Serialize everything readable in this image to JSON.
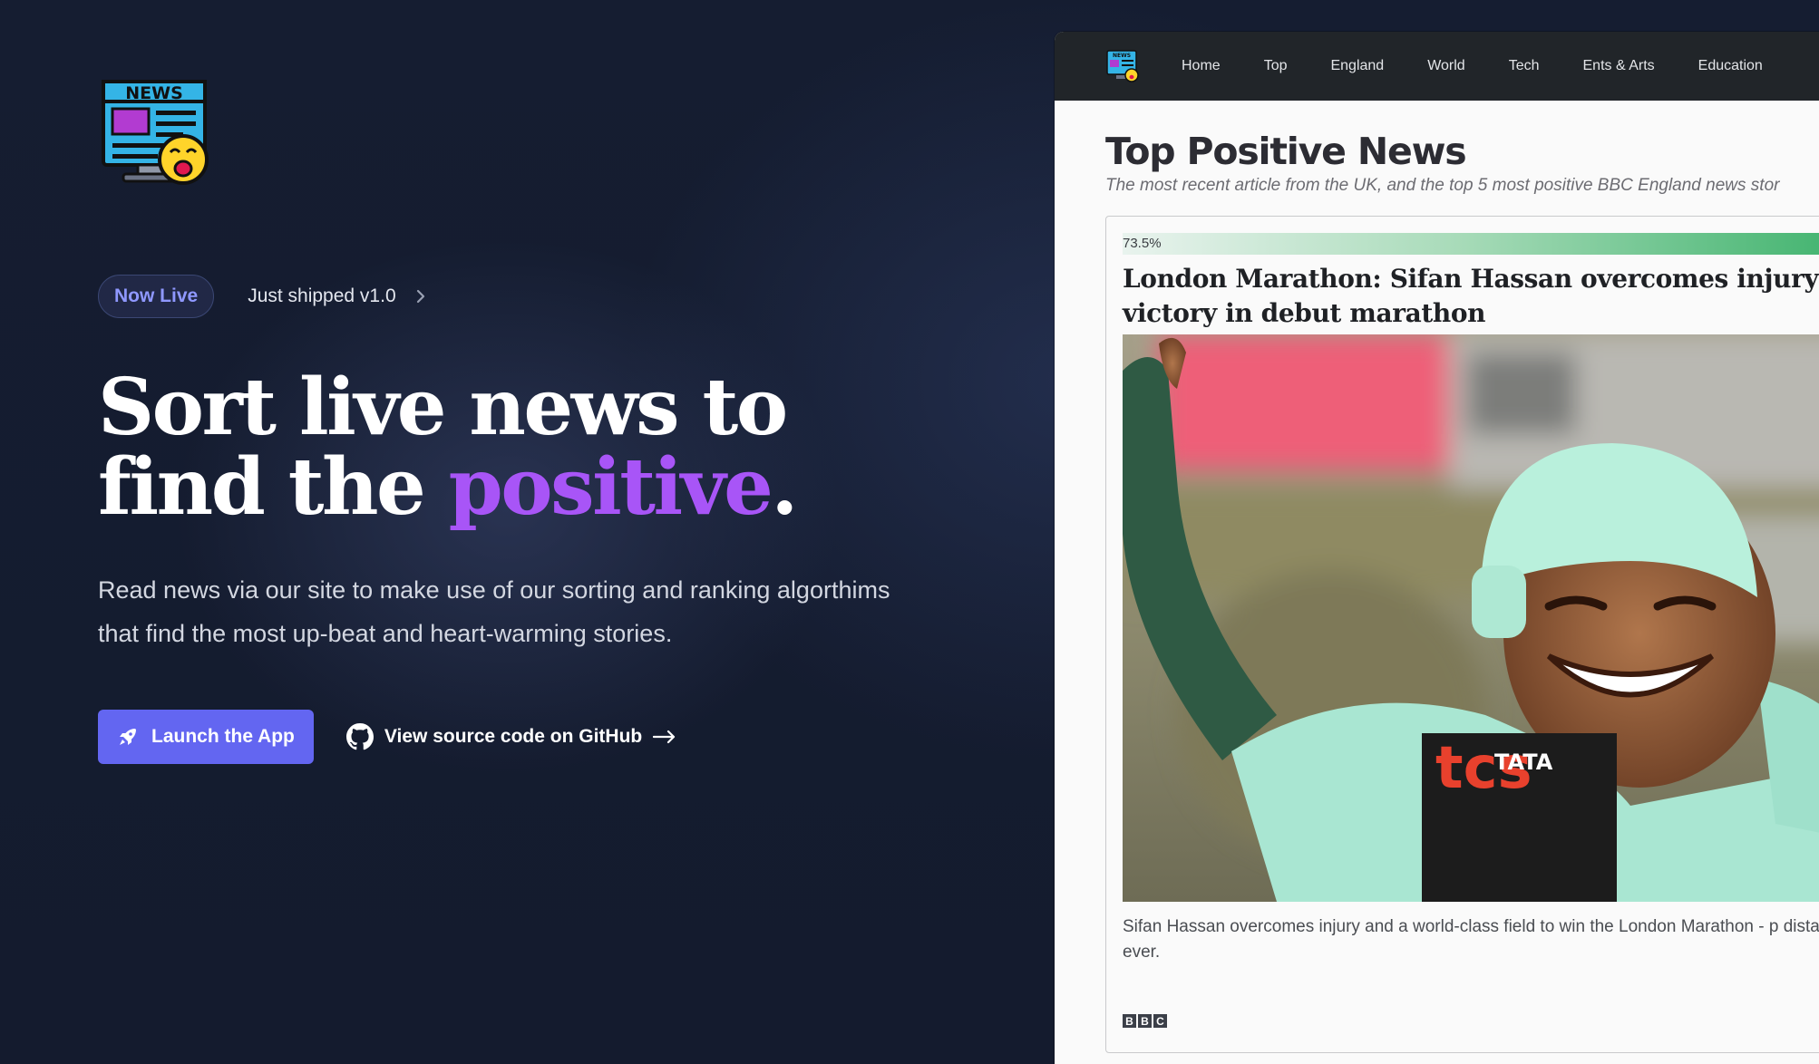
{
  "hero": {
    "logo_text": "NEWS",
    "badge": {
      "pill": "Now Live",
      "text": "Just shipped v1.0"
    },
    "headline": {
      "line1": "Sort live news to",
      "line2_prefix": "find the ",
      "line2_accent": "positive",
      "line2_suffix": "."
    },
    "subtitle": "Read news via our site to make use of our sorting and ranking algorthims that find the most up-beat and heart-warming stories.",
    "launch_button": "Launch the App",
    "github_link": "View source code on GitHub"
  },
  "preview": {
    "nav": {
      "logo_text": "NEWS",
      "items": [
        "Home",
        "Top",
        "England",
        "World",
        "Tech",
        "Ents & Arts",
        "Education"
      ]
    },
    "title": "Top Positive News",
    "subtitle": "The most recent article from the UK, and the top 5 most positive BBC England news stor",
    "article": {
      "score_label": "73.5%",
      "score": 0.735,
      "title": "London Marathon: Sifan Hassan overcomes injury to victory in debut marathon",
      "photo_text": "TATA",
      "photo_text2": "tcs",
      "caption": "Sifan Hassan overcomes injury and a world-class field to win the London Marathon - p distance ever.",
      "source": [
        "B",
        "B",
        "C"
      ]
    }
  },
  "colors": {
    "background": "#141b2e",
    "accent": "#a855f7",
    "button": "#6366f1",
    "pill_text": "#8f98ff",
    "navbar": "#212529",
    "score_green": "#3bb16a"
  },
  "icons": {
    "badge_chevron": "chevron-right-icon",
    "launch": "rocket-icon",
    "github": "github-icon",
    "arrow": "arrow-right-icon"
  }
}
